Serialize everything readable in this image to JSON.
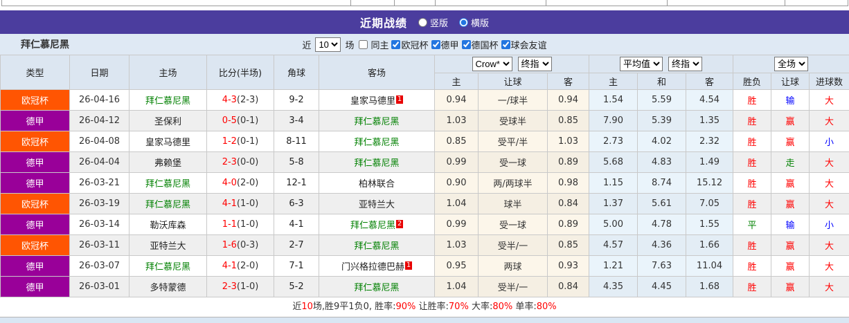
{
  "header": {
    "title": "近期战绩",
    "radio_vertical": "竖版",
    "radio_horizontal": "横版",
    "selected_layout": "横版"
  },
  "filterbar": {
    "team": "拜仁慕尼黑",
    "near_label": "近",
    "count_value": "10",
    "games_label": "场",
    "checkboxes": [
      {
        "label": "同主",
        "checked": false
      },
      {
        "label": "欧冠杯",
        "checked": true
      },
      {
        "label": "德甲",
        "checked": true
      },
      {
        "label": "德国杯",
        "checked": true
      },
      {
        "label": "球会友谊",
        "checked": true
      }
    ]
  },
  "table": {
    "selects": {
      "odds_company": "Crow*",
      "odds_time": "终指",
      "avg_company": "平均值",
      "avg_time": "终指",
      "result_scope": "全场"
    },
    "headers": {
      "type": "类型",
      "date": "日期",
      "home": "主场",
      "score": "比分(半场)",
      "corner": "角球",
      "away": "客场",
      "h": "主",
      "handicap": "让球",
      "a": "客",
      "h2": "主",
      "draw": "和",
      "a2": "客",
      "wl": "胜负",
      "hc": "让球",
      "goals": "进球数"
    },
    "rows": [
      {
        "type_label": "欧冠杯",
        "type_key": "ucl",
        "date": "26-04-16",
        "home": "拜仁慕尼黑",
        "home_self": true,
        "home_card": null,
        "score": "4-3",
        "half": "(2-3)",
        "corner": "9-2",
        "away": "皇家马德里",
        "away_self": false,
        "away_card": "1",
        "odds": [
          "0.94",
          "一/球半",
          "0.94"
        ],
        "avg": [
          "1.54",
          "5.59",
          "4.54"
        ],
        "result": [
          {
            "t": "胜",
            "c": "red"
          },
          {
            "t": "输",
            "c": "blue"
          },
          {
            "t": "大",
            "c": "red"
          }
        ]
      },
      {
        "type_label": "德甲",
        "type_key": "league",
        "date": "26-04-12",
        "home": "圣保利",
        "home_self": false,
        "home_card": null,
        "score": "0-5",
        "half": "(0-1)",
        "corner": "3-4",
        "away": "拜仁慕尼黑",
        "away_self": true,
        "away_card": null,
        "odds": [
          "1.03",
          "受球半",
          "0.85"
        ],
        "avg": [
          "7.90",
          "5.39",
          "1.35"
        ],
        "result": [
          {
            "t": "胜",
            "c": "red"
          },
          {
            "t": "赢",
            "c": "red"
          },
          {
            "t": "大",
            "c": "red"
          }
        ]
      },
      {
        "type_label": "欧冠杯",
        "type_key": "ucl",
        "date": "26-04-08",
        "home": "皇家马德里",
        "home_self": false,
        "home_card": null,
        "score": "1-2",
        "half": "(0-1)",
        "corner": "8-11",
        "away": "拜仁慕尼黑",
        "away_self": true,
        "away_card": null,
        "odds": [
          "0.85",
          "受平/半",
          "1.03"
        ],
        "avg": [
          "2.73",
          "4.02",
          "2.32"
        ],
        "result": [
          {
            "t": "胜",
            "c": "red"
          },
          {
            "t": "赢",
            "c": "red"
          },
          {
            "t": "小",
            "c": "blue"
          }
        ]
      },
      {
        "type_label": "德甲",
        "type_key": "league",
        "date": "26-04-04",
        "home": "弗赖堡",
        "home_self": false,
        "home_card": null,
        "score": "2-3",
        "half": "(0-0)",
        "corner": "5-8",
        "away": "拜仁慕尼黑",
        "away_self": true,
        "away_card": null,
        "odds": [
          "0.99",
          "受一球",
          "0.89"
        ],
        "avg": [
          "5.68",
          "4.83",
          "1.49"
        ],
        "result": [
          {
            "t": "胜",
            "c": "red"
          },
          {
            "t": "走",
            "c": "green"
          },
          {
            "t": "大",
            "c": "red"
          }
        ]
      },
      {
        "type_label": "德甲",
        "type_key": "league",
        "date": "26-03-21",
        "home": "拜仁慕尼黑",
        "home_self": true,
        "home_card": null,
        "score": "4-0",
        "half": "(2-0)",
        "corner": "12-1",
        "away": "柏林联合",
        "away_self": false,
        "away_card": null,
        "odds": [
          "0.90",
          "两/两球半",
          "0.98"
        ],
        "avg": [
          "1.15",
          "8.74",
          "15.12"
        ],
        "result": [
          {
            "t": "胜",
            "c": "red"
          },
          {
            "t": "赢",
            "c": "red"
          },
          {
            "t": "大",
            "c": "red"
          }
        ]
      },
      {
        "type_label": "欧冠杯",
        "type_key": "ucl",
        "date": "26-03-19",
        "home": "拜仁慕尼黑",
        "home_self": true,
        "home_card": null,
        "score": "4-1",
        "half": "(1-0)",
        "corner": "6-3",
        "away": "亚特兰大",
        "away_self": false,
        "away_card": null,
        "odds": [
          "1.04",
          "球半",
          "0.84"
        ],
        "avg": [
          "1.37",
          "5.61",
          "7.05"
        ],
        "result": [
          {
            "t": "胜",
            "c": "red"
          },
          {
            "t": "赢",
            "c": "red"
          },
          {
            "t": "大",
            "c": "red"
          }
        ]
      },
      {
        "type_label": "德甲",
        "type_key": "league",
        "date": "26-03-14",
        "home": "勒沃库森",
        "home_self": false,
        "home_card": null,
        "score": "1-1",
        "half": "(1-0)",
        "corner": "4-1",
        "away": "拜仁慕尼黑",
        "away_self": true,
        "away_card": "2",
        "odds": [
          "0.99",
          "受一球",
          "0.89"
        ],
        "avg": [
          "5.00",
          "4.78",
          "1.55"
        ],
        "result": [
          {
            "t": "平",
            "c": "green"
          },
          {
            "t": "输",
            "c": "blue"
          },
          {
            "t": "小",
            "c": "blue"
          }
        ]
      },
      {
        "type_label": "欧冠杯",
        "type_key": "ucl",
        "date": "26-03-11",
        "home": "亚特兰大",
        "home_self": false,
        "home_card": null,
        "score": "1-6",
        "half": "(0-3)",
        "corner": "2-7",
        "away": "拜仁慕尼黑",
        "away_self": true,
        "away_card": null,
        "odds": [
          "1.03",
          "受半/一",
          "0.85"
        ],
        "avg": [
          "4.57",
          "4.36",
          "1.66"
        ],
        "result": [
          {
            "t": "胜",
            "c": "red"
          },
          {
            "t": "赢",
            "c": "red"
          },
          {
            "t": "大",
            "c": "red"
          }
        ]
      },
      {
        "type_label": "德甲",
        "type_key": "league",
        "date": "26-03-07",
        "home": "拜仁慕尼黑",
        "home_self": true,
        "home_card": null,
        "score": "4-1",
        "half": "(2-0)",
        "corner": "7-1",
        "away": "门兴格拉德巴赫",
        "away_self": false,
        "away_card": "1",
        "odds": [
          "0.95",
          "两球",
          "0.93"
        ],
        "avg": [
          "1.21",
          "7.63",
          "11.04"
        ],
        "result": [
          {
            "t": "胜",
            "c": "red"
          },
          {
            "t": "赢",
            "c": "red"
          },
          {
            "t": "大",
            "c": "red"
          }
        ]
      },
      {
        "type_label": "德甲",
        "type_key": "league",
        "date": "26-03-01",
        "home": "多特蒙德",
        "home_self": false,
        "home_card": null,
        "score": "2-3",
        "half": "(1-0)",
        "corner": "5-2",
        "away": "拜仁慕尼黑",
        "away_self": true,
        "away_card": null,
        "odds": [
          "1.04",
          "受半/一",
          "0.84"
        ],
        "avg": [
          "4.35",
          "4.45",
          "1.68"
        ],
        "result": [
          {
            "t": "胜",
            "c": "red"
          },
          {
            "t": "赢",
            "c": "red"
          },
          {
            "t": "大",
            "c": "red"
          }
        ]
      }
    ]
  },
  "footer": {
    "segments": [
      {
        "t": "近"
      },
      {
        "t": "10",
        "red": true
      },
      {
        "t": "场,胜9平1负0, 胜率:"
      },
      {
        "t": "90%",
        "red": true
      },
      {
        "t": " 让胜率:"
      },
      {
        "t": "70%",
        "red": true
      },
      {
        "t": " 大率:"
      },
      {
        "t": "80%",
        "red": true
      },
      {
        "t": " 单率:"
      },
      {
        "t": "80%",
        "red": true
      }
    ]
  },
  "colors": {
    "accent_purple": "#4B3D9E",
    "type_ucl": "#FF5502",
    "type_league": "#990099",
    "team_green": "#008000",
    "win_red": "#FF0000",
    "lose_blue": "#0000FF",
    "draw_green": "#008000",
    "odds_bg": "#FCF6EA",
    "avg_bg": "#EAF4FB",
    "header_bg": "#DCE6F1"
  }
}
